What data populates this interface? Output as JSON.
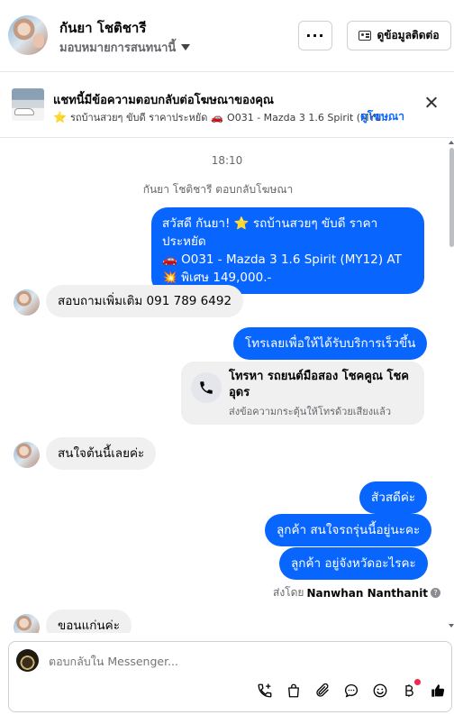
{
  "header": {
    "contact_name": "กันยา โชติชารี",
    "assign_label": "มอบหมายการสนทนานี้",
    "more_label": "···",
    "contact_info_label": "ดูข้อมูลติดต่อ"
  },
  "ad_banner": {
    "title": "แชทนี้มีข้อความตอบกลับต่อโฆษณาของคุณ",
    "star": "⭐",
    "subtitle_part1": "รถบ้านสวยๆ ขับดี ราคาประหยัด",
    "car_emoji": "🚗",
    "subtitle_part2": "O031 - Mazda 3 1.6 Spirit (MY1...",
    "view_ad_link": "ดูโฆษณา"
  },
  "thread": {
    "timestamp": "18:10",
    "replied_note": "กันยา โชติชารี ตอบกลับโฆษณา",
    "messages": [
      {
        "dir": "out",
        "lines": [
          "สวัสดี กันยา! ⭐ รถบ้านสวยๆ ขับดี ราคาประหยัด",
          "🚗 O031 - Mazda 3 1.6 Spirit (MY12) AT",
          "💥 พิเศษ 149,000.-"
        ]
      },
      {
        "dir": "in",
        "text": "สอบถามเพิ่มเติม 091 789 6492"
      },
      {
        "dir": "out",
        "text": "โทรเลยเพื่อให้ได้รับบริการเร็วขึ้น"
      },
      {
        "dir": "in",
        "text": "สนใจต้นนี้เลยค่ะ"
      },
      {
        "dir": "out",
        "text": "สัวสดีค่ะ"
      },
      {
        "dir": "out",
        "text": "ลูกค้า สนใจรถรุ่นนี้อยู่นะคะ"
      },
      {
        "dir": "out",
        "text": "ลูกค้า อยู่จังหวัดอะไรคะ"
      },
      {
        "dir": "in",
        "text": "ขอนแก่นค่ะ"
      }
    ],
    "call_card": {
      "title": "โทรหา รถยนต์มือสอง โชคคูณ โชค อุดร",
      "subtitle": "ส่งข้อความกระตุ้นให้โทรด้วยเสียงแล้ว"
    },
    "sent_by_prefix": "ส่งโดย",
    "sent_by_name": "Nanwhan Nanthanit",
    "info_glyph": "?"
  },
  "composer": {
    "placeholder": "ตอบกลับใน Messenger...",
    "tools": [
      "add-call-icon",
      "bag-icon",
      "paperclip-icon",
      "chat-bubble-icon",
      "emoji-icon",
      "baht-icon",
      "like-icon"
    ]
  },
  "colors": {
    "accent": "#0866ff",
    "incoming_bubble": "#f0f0f0",
    "badge": "#f02849"
  }
}
